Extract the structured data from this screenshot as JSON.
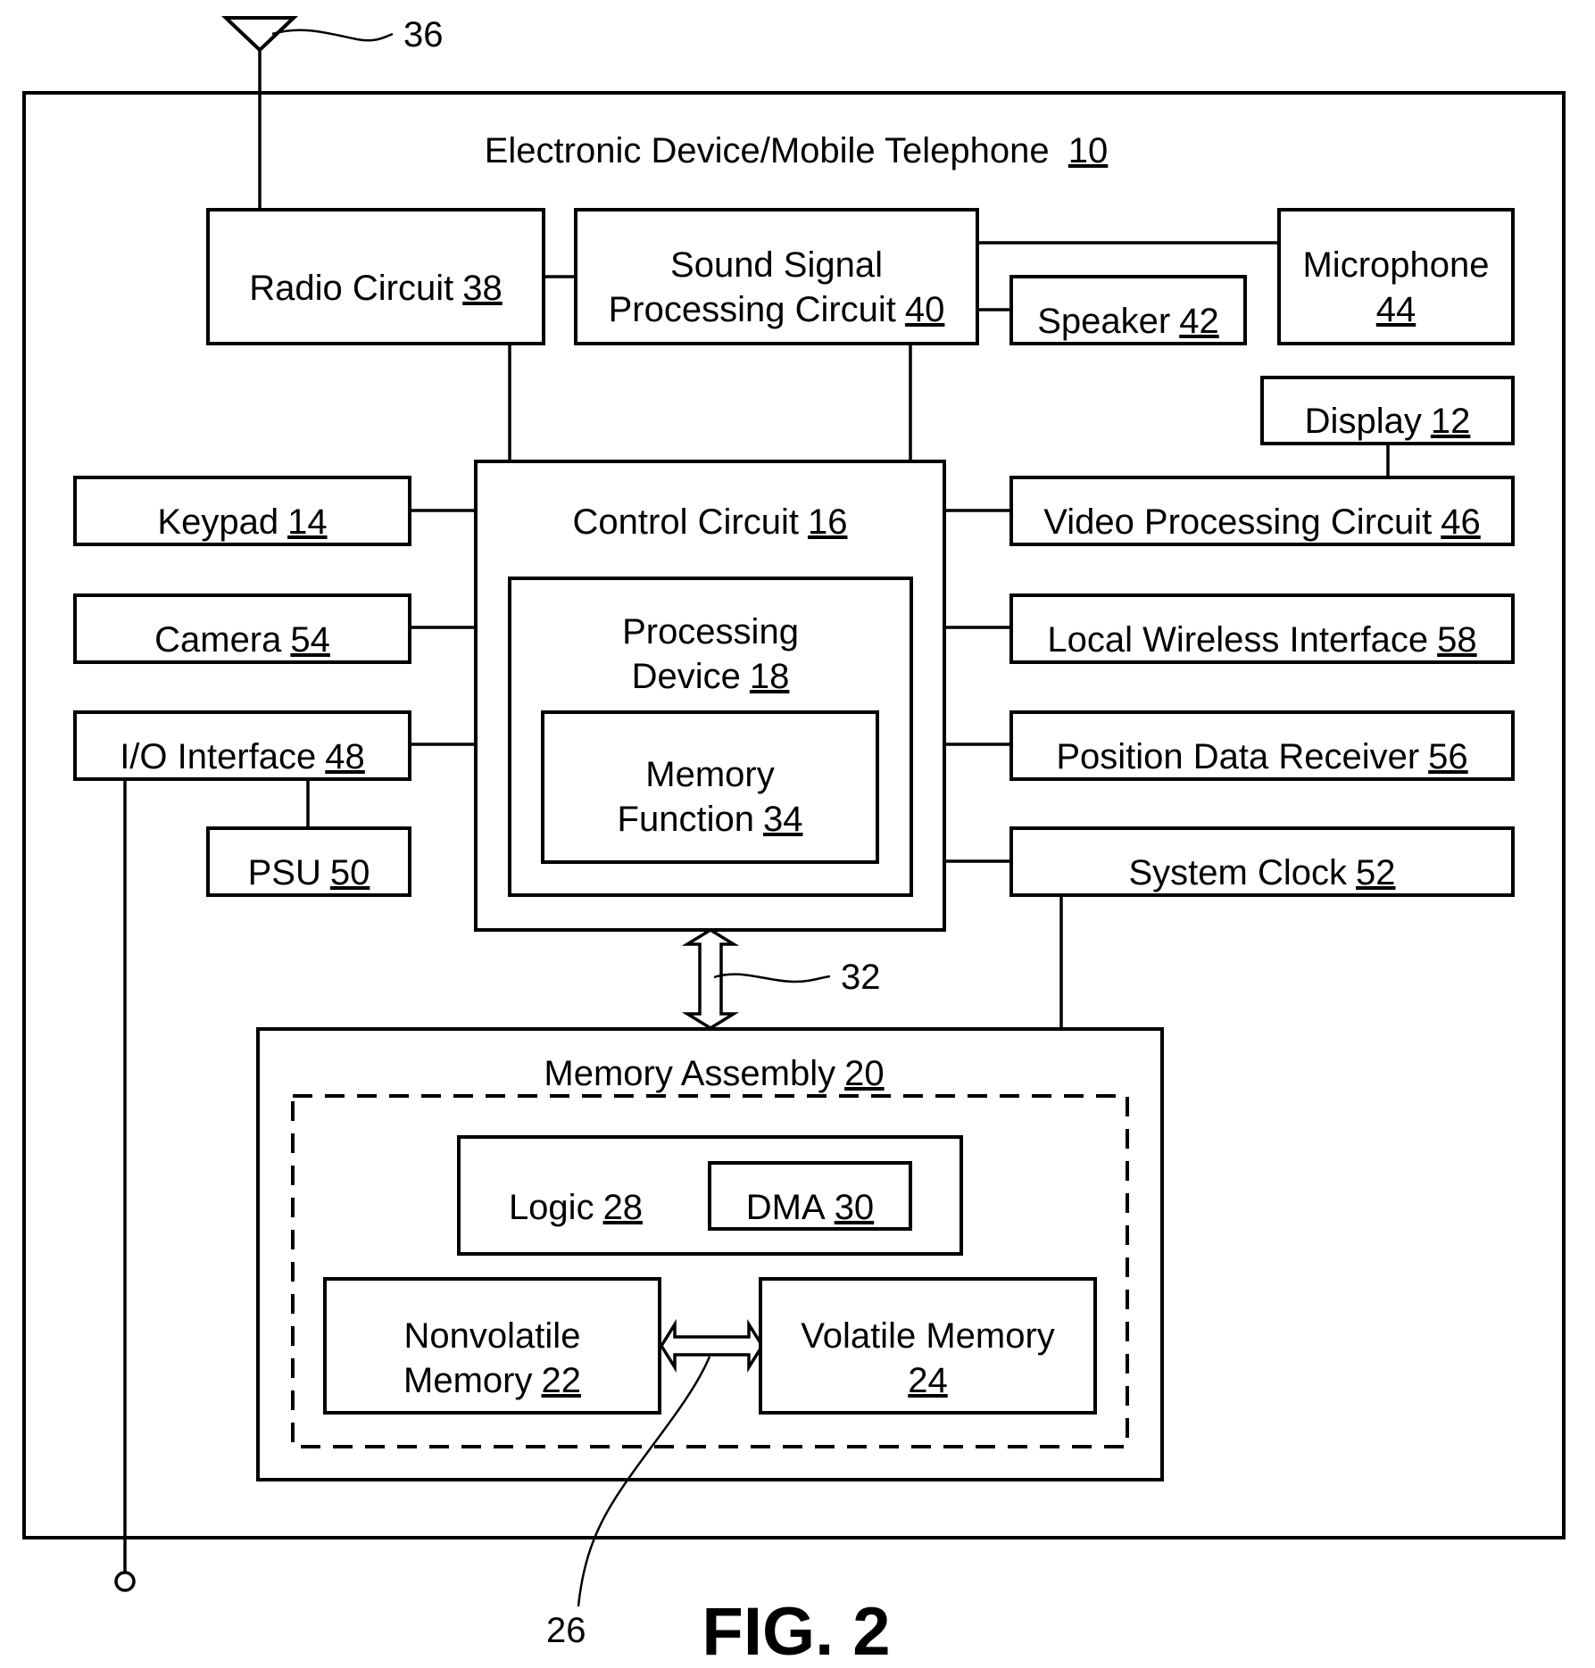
{
  "figure": {
    "caption": "FIG. 2",
    "device": {
      "name": "Electronic Device/Mobile Telephone",
      "ref": "10"
    }
  },
  "reference_labels": {
    "antenna": "36",
    "bus": "32",
    "memory_link": "26"
  },
  "blocks": {
    "radio": {
      "lines": [
        "Radio Circuit"
      ],
      "ref": "38"
    },
    "sound": {
      "lines": [
        "Sound Signal",
        "Processing Circuit"
      ],
      "ref": "40"
    },
    "speaker": {
      "lines": [
        "Speaker"
      ],
      "ref": "42"
    },
    "microphone": {
      "lines": [
        "Microphone"
      ],
      "ref": "44"
    },
    "display": {
      "lines": [
        "Display"
      ],
      "ref": "12"
    },
    "keypad": {
      "lines": [
        "Keypad"
      ],
      "ref": "14"
    },
    "camera": {
      "lines": [
        "Camera"
      ],
      "ref": "54"
    },
    "io": {
      "lines": [
        "I/O Interface"
      ],
      "ref": "48"
    },
    "psu": {
      "lines": [
        "PSU"
      ],
      "ref": "50"
    },
    "control": {
      "lines": [
        "Control Circuit"
      ],
      "ref": "16"
    },
    "processing": {
      "lines": [
        "Processing",
        "Device"
      ],
      "ref": "18"
    },
    "memfunc": {
      "lines": [
        "Memory",
        "Function"
      ],
      "ref": "34"
    },
    "video": {
      "lines": [
        "Video Processing Circuit"
      ],
      "ref": "46"
    },
    "wireless": {
      "lines": [
        "Local Wireless Interface"
      ],
      "ref": "58"
    },
    "position": {
      "lines": [
        "Position Data Receiver"
      ],
      "ref": "56"
    },
    "clock": {
      "lines": [
        "System Clock"
      ],
      "ref": "52"
    },
    "memassembly": {
      "lines": [
        "Memory Assembly"
      ],
      "ref": "20"
    },
    "logic": {
      "lines": [
        "Logic"
      ],
      "ref": "28"
    },
    "dma": {
      "lines": [
        "DMA"
      ],
      "ref": "30"
    },
    "nonvolatile": {
      "lines": [
        "Nonvolatile",
        "Memory"
      ],
      "ref": "22"
    },
    "volatile": {
      "lines": [
        "Volatile Memory",
        ""
      ],
      "ref": "24"
    }
  }
}
